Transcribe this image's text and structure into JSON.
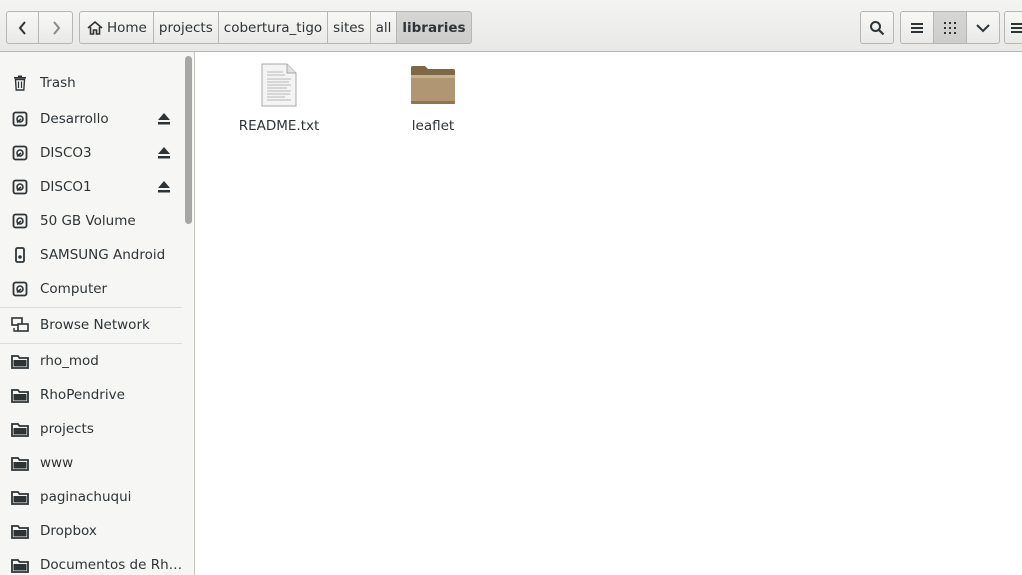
{
  "header": {
    "breadcrumbs": [
      "Home",
      "projects",
      "cobertura_tigo",
      "sites",
      "all",
      "libraries"
    ]
  },
  "sidebar": {
    "items": [
      {
        "label": "Trash",
        "icon": "trash-icon"
      },
      {
        "label": "Desarrollo",
        "icon": "drive-icon",
        "eject": true
      },
      {
        "label": "DISCO3",
        "icon": "drive-icon",
        "eject": true
      },
      {
        "label": "DISCO1",
        "icon": "drive-icon",
        "eject": true
      },
      {
        "label": "50 GB Volume",
        "icon": "drive-icon"
      },
      {
        "label": "SAMSUNG Android",
        "icon": "phone-icon"
      },
      {
        "label": "Computer",
        "icon": "drive-icon"
      },
      {
        "label": "Browse Network",
        "icon": "network-icon"
      },
      {
        "label": "rho_mod",
        "icon": "folder-icon"
      },
      {
        "label": "RhoPendrive",
        "icon": "folder-icon"
      },
      {
        "label": "projects",
        "icon": "folder-icon"
      },
      {
        "label": "www",
        "icon": "folder-icon"
      },
      {
        "label": "paginachuqui",
        "icon": "folder-icon"
      },
      {
        "label": "Dropbox",
        "icon": "folder-icon"
      },
      {
        "label": "Documentos de Rh…",
        "icon": "folder-icon"
      }
    ]
  },
  "main": {
    "files": [
      {
        "name": "README.txt",
        "icon": "text-file-icon"
      },
      {
        "name": "leaflet",
        "icon": "folder-icon"
      }
    ]
  },
  "colors": {
    "folder": "#a68c67",
    "text": "#2e3436",
    "sidebar_bg": "#f6f6f5"
  }
}
